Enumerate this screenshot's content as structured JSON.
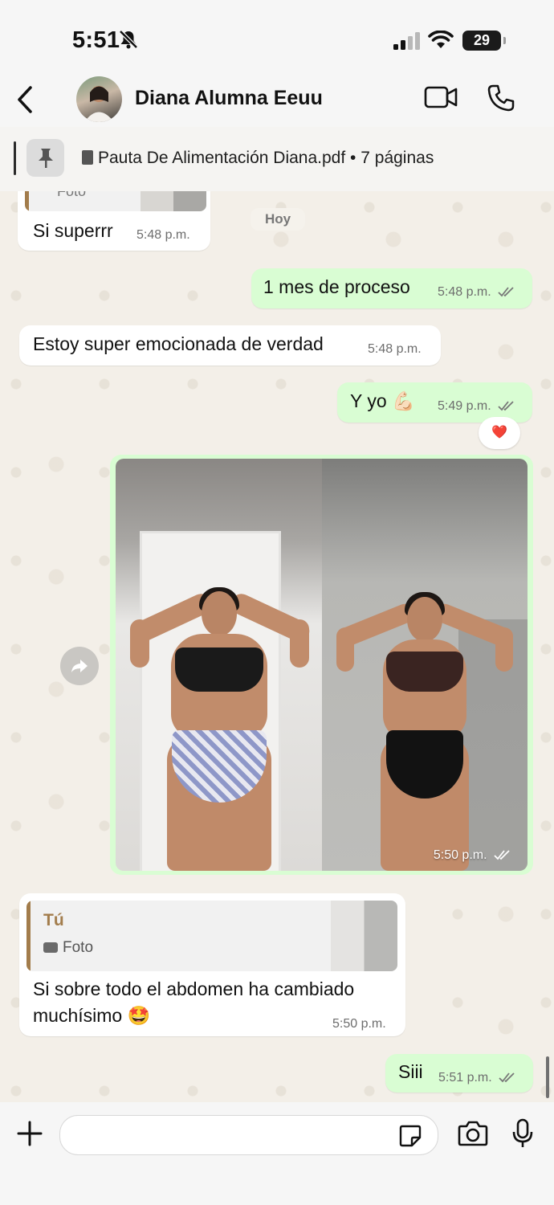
{
  "status_bar": {
    "time": "5:51",
    "battery": "29"
  },
  "header": {
    "contact_name": "Diana Alumna Eeuu"
  },
  "pinned": {
    "file_name": "Pauta De Alimentación Diana.pdf",
    "separator": "•",
    "pages": "7 páginas"
  },
  "chat": {
    "day_label": "Hoy",
    "messages": [
      {
        "dir": "in",
        "text": "Si superrr",
        "time": "5:48 p.m."
      },
      {
        "dir": "out",
        "text": "1 mes de proceso",
        "time": "5:48 p.m."
      },
      {
        "dir": "in",
        "text": "Estoy super emocionada de verdad",
        "time": "5:48 p.m."
      },
      {
        "dir": "out",
        "text": "Y yo 💪🏻",
        "time": "5:49 p.m.",
        "reaction": "❤️"
      },
      {
        "dir": "out",
        "type": "photo",
        "time": "5:50 p.m."
      },
      {
        "dir": "in",
        "reply_to": {
          "author": "Tú",
          "kind": "Foto"
        },
        "text_line1": "Si sobre todo el abdomen ha cambiado",
        "text_line2": "muchísimo 🤩",
        "time": "5:50 p.m."
      },
      {
        "dir": "out",
        "text": "Siii",
        "time": "5:51 p.m."
      }
    ]
  },
  "quoted_above": {
    "kind": "Foto"
  },
  "composer": {
    "placeholder": ""
  },
  "colors": {
    "outgoing": "#d9fdd3",
    "incoming": "#ffffff",
    "reply_accent": "#a27c4b",
    "background": "#f3efe8"
  },
  "icons": [
    "bell-slash-icon",
    "signal-icon",
    "wifi-icon",
    "back-icon",
    "video-call-icon",
    "phone-icon",
    "pin-icon",
    "document-icon",
    "forward-icon",
    "plus-icon",
    "sticker-icon",
    "camera-icon",
    "mic-icon",
    "read-ticks-icon"
  ]
}
